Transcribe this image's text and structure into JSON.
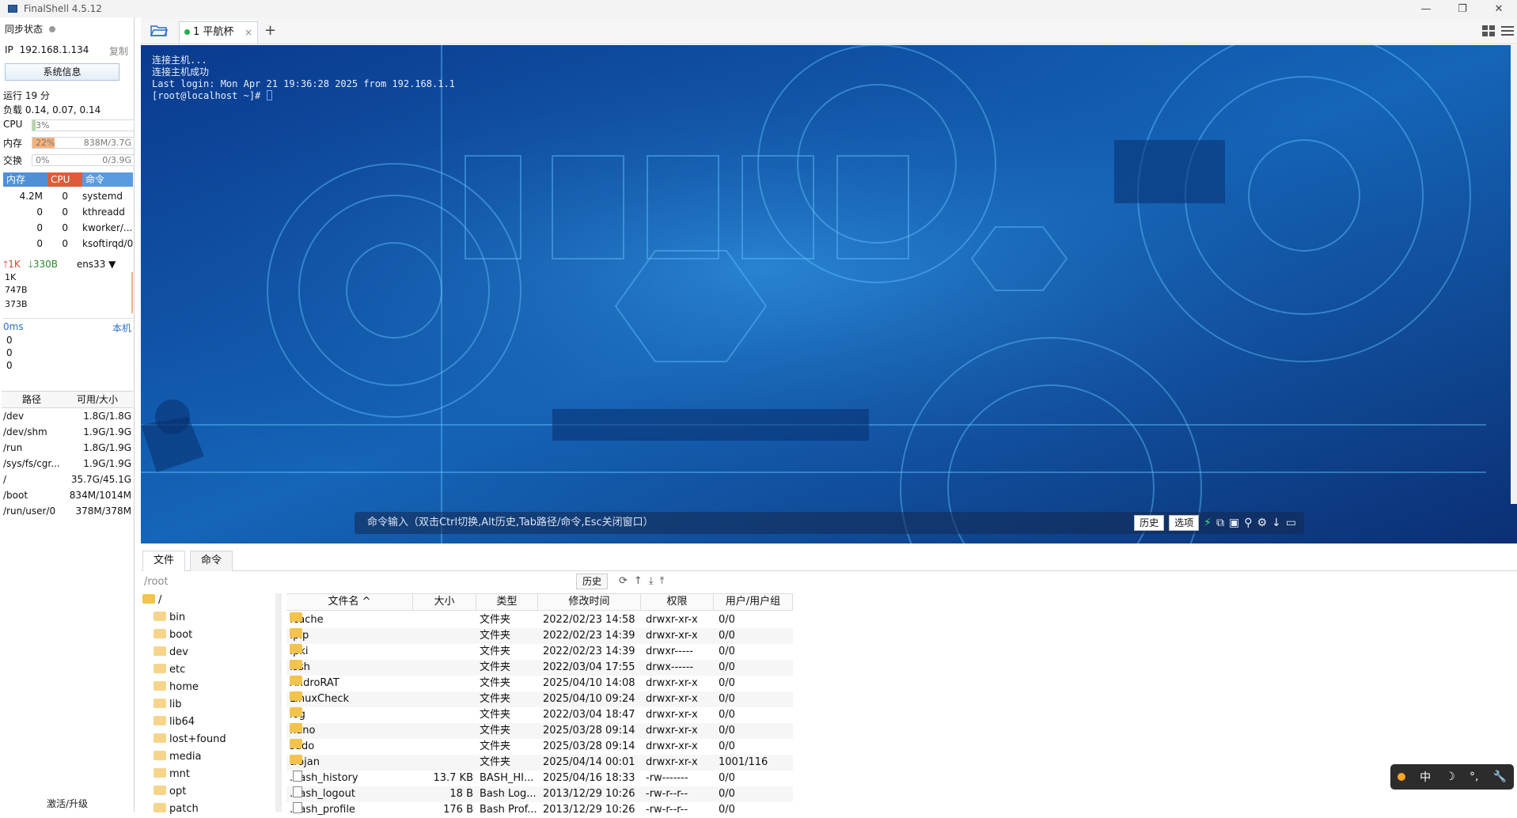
{
  "window": {
    "title": "FinalShell 4.5.12",
    "controls": [
      "—",
      "❐",
      "✕"
    ]
  },
  "left": {
    "sync_label": "同步状态",
    "ip_label": "IP",
    "ip": "192.168.1.134",
    "copy": "复制",
    "sysinfo": "系统信息",
    "uptime": "运行 19 分",
    "load": "负载 0.14, 0.07, 0.14",
    "meters": [
      {
        "label": "CPU",
        "pct": "3%",
        "value": "",
        "fill": 0.03,
        "color": "#b5d6a7"
      },
      {
        "label": "内存",
        "pct": "22%",
        "value": "838M/3.7G",
        "fill": 0.22,
        "color": "#f7b27a"
      },
      {
        "label": "交换",
        "pct": "0%",
        "value": "0/3.9G",
        "fill": 0,
        "color": "#b5d6a7"
      }
    ],
    "proc_head": {
      "mem": "内存",
      "cpu": "CPU",
      "cmd": "命令",
      "mem_color": "#4f8fd6",
      "cpu_color": "#e05b3a",
      "cmd_color": "#5a9be0"
    },
    "processes": [
      {
        "mem": "4.2M",
        "cpu": "0",
        "cmd": "systemd"
      },
      {
        "mem": "0",
        "cpu": "0",
        "cmd": "kthreadd"
      },
      {
        "mem": "0",
        "cpu": "0",
        "cmd": "kworker/..."
      },
      {
        "mem": "0",
        "cpu": "0",
        "cmd": "ksoftirqd/0"
      }
    ],
    "net": {
      "up": "1K",
      "down": "330B",
      "iface": "ens33",
      "ticks": [
        "1K",
        "747B",
        "373B"
      ]
    },
    "latency": {
      "value": "0ms",
      "target": "本机",
      "ticks": [
        "0",
        "0",
        "0"
      ]
    },
    "disk_head": {
      "path": "路径",
      "size": "可用/大小"
    },
    "disks": [
      {
        "path": "/dev",
        "size": "1.8G/1.8G"
      },
      {
        "path": "/dev/shm",
        "size": "1.9G/1.9G"
      },
      {
        "path": "/run",
        "size": "1.8G/1.9G"
      },
      {
        "path": "/sys/fs/cgr...",
        "size": "1.9G/1.9G"
      },
      {
        "path": "/",
        "size": "35.7G/45.1G"
      },
      {
        "path": "/boot",
        "size": "834M/1014M"
      },
      {
        "path": "/run/user/0",
        "size": "378M/378M"
      }
    ],
    "activate": "激活/升级"
  },
  "tabbar": {
    "tab_label": "1 平航杯",
    "close": "×",
    "add": "+"
  },
  "terminal": {
    "lines": [
      "连接主机...",
      "连接主机成功",
      "Last login: Mon Apr 21 19:36:28 2025 from 192.168.1.1",
      "[root@localhost ~]# "
    ],
    "cmd_placeholder": "命令输入（双击Ctrl切换,Alt历史,Tab路径/命令,Esc关闭窗口）",
    "history_btn": "历史",
    "options_btn": "选项"
  },
  "bottom": {
    "tabs": [
      "文件",
      "命令"
    ],
    "path": "/root",
    "history": "历史",
    "tree": [
      {
        "name": "/",
        "level": 0
      },
      {
        "name": "bin",
        "level": 1
      },
      {
        "name": "boot",
        "level": 1
      },
      {
        "name": "dev",
        "level": 1
      },
      {
        "name": "etc",
        "level": 1
      },
      {
        "name": "home",
        "level": 1
      },
      {
        "name": "lib",
        "level": 1
      },
      {
        "name": "lib64",
        "level": 1
      },
      {
        "name": "lost+found",
        "level": 1
      },
      {
        "name": "media",
        "level": 1
      },
      {
        "name": "mnt",
        "level": 1
      },
      {
        "name": "opt",
        "level": 1
      },
      {
        "name": "patch",
        "level": 1
      }
    ],
    "columns": [
      "文件名 ^",
      "大小",
      "类型",
      "修改时间",
      "权限",
      "用户/用户组"
    ],
    "files": [
      {
        "name": ".cache",
        "size": "",
        "type": "文件夹",
        "mtime": "2022/02/23 14:58",
        "perm": "drwxr-xr-x",
        "owner": "0/0",
        "dir": true
      },
      {
        "name": ".pip",
        "size": "",
        "type": "文件夹",
        "mtime": "2022/02/23 14:39",
        "perm": "drwxr-xr-x",
        "owner": "0/0",
        "dir": true
      },
      {
        "name": ".pki",
        "size": "",
        "type": "文件夹",
        "mtime": "2022/02/23 14:39",
        "perm": "drwxr-----",
        "owner": "0/0",
        "dir": true
      },
      {
        "name": ".ssh",
        "size": "",
        "type": "文件夹",
        "mtime": "2022/03/04 17:55",
        "perm": "drwx------",
        "owner": "0/0",
        "dir": true
      },
      {
        "name": "AndroRAT",
        "size": "",
        "type": "文件夹",
        "mtime": "2025/04/10 14:08",
        "perm": "drwxr-xr-x",
        "owner": "0/0",
        "dir": true
      },
      {
        "name": "LinuxCheck",
        "size": "",
        "type": "文件夹",
        "mtime": "2025/04/10 09:24",
        "perm": "drwxr-xr-x",
        "owner": "0/0",
        "dir": true
      },
      {
        "name": "log",
        "size": "",
        "type": "文件夹",
        "mtime": "2022/03/04 18:47",
        "perm": "drwxr-xr-x",
        "owner": "0/0",
        "dir": true
      },
      {
        "name": "nano",
        "size": "",
        "type": "文件夹",
        "mtime": "2025/03/28 09:14",
        "perm": "drwxr-xr-x",
        "owner": "0/0",
        "dir": true
      },
      {
        "name": "sudo",
        "size": "",
        "type": "文件夹",
        "mtime": "2025/03/28 09:14",
        "perm": "drwxr-xr-x",
        "owner": "0/0",
        "dir": true
      },
      {
        "name": "trojan",
        "size": "",
        "type": "文件夹",
        "mtime": "2025/04/14 00:01",
        "perm": "drwxr-xr-x",
        "owner": "1001/116",
        "dir": true
      },
      {
        "name": ".bash_history",
        "size": "13.7 KB",
        "type": "BASH_HI...",
        "mtime": "2025/04/16 18:33",
        "perm": "-rw-------",
        "owner": "0/0",
        "dir": false
      },
      {
        "name": ".bash_logout",
        "size": "18 B",
        "type": "Bash Log...",
        "mtime": "2013/12/29 10:26",
        "perm": "-rw-r--r--",
        "owner": "0/0",
        "dir": false
      },
      {
        "name": ".bash_profile",
        "size": "176 B",
        "type": "Bash Prof...",
        "mtime": "2013/12/29 10:26",
        "perm": "-rw-r--r--",
        "owner": "0/0",
        "dir": false
      }
    ]
  },
  "ime": {
    "lang": "中",
    "moon": "☽",
    "punct": "°,",
    "tool": "🔧"
  }
}
